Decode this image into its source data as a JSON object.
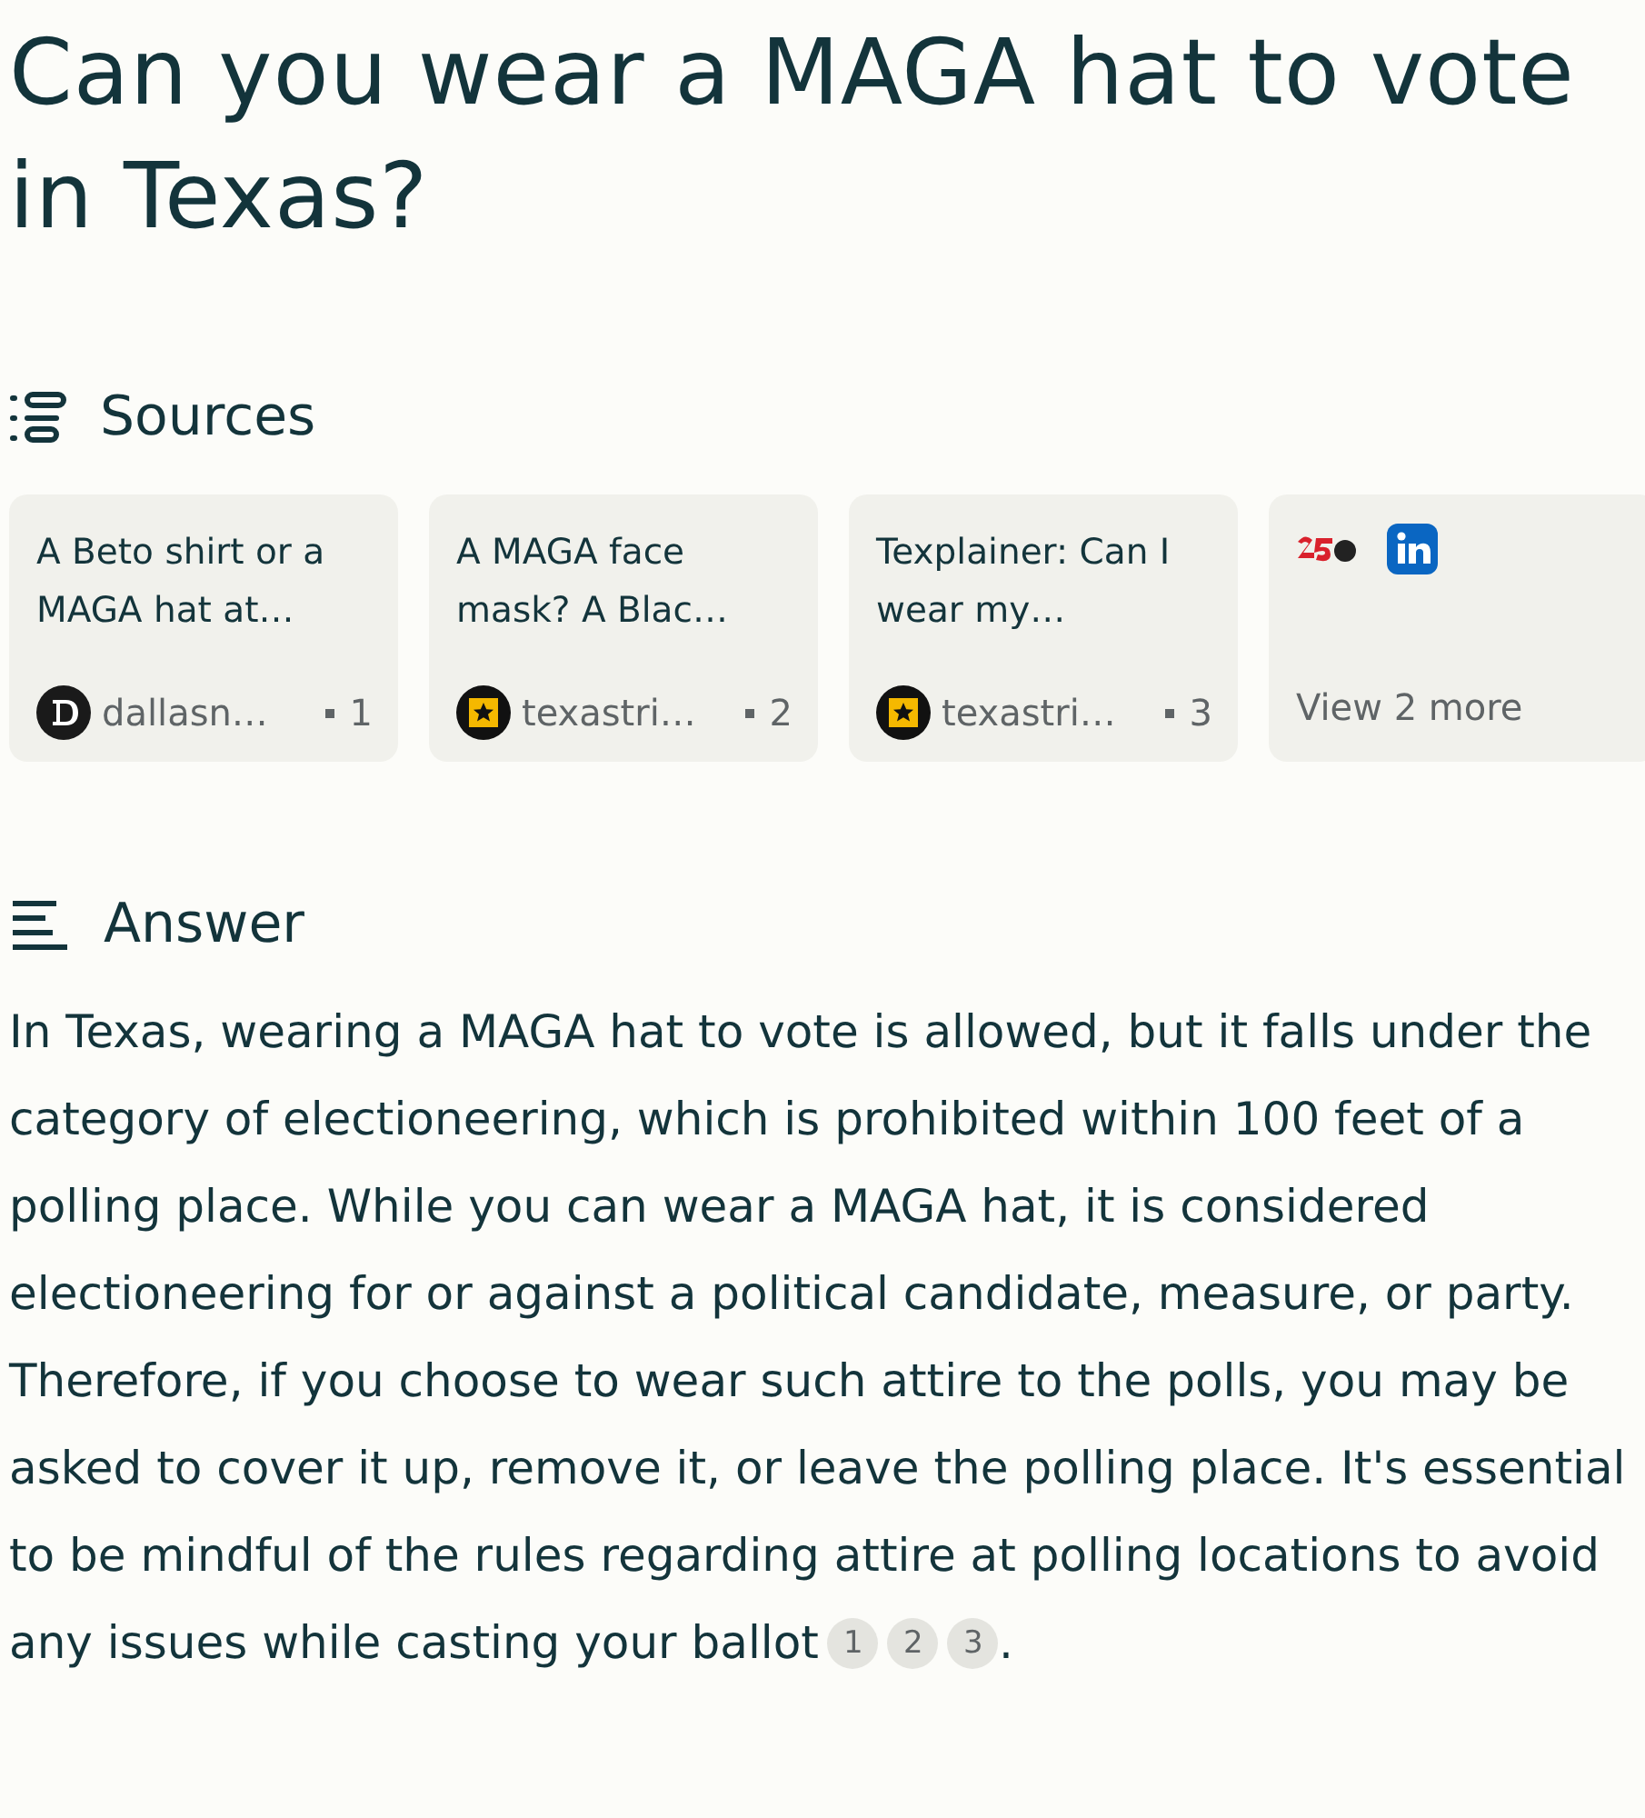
{
  "title": "Can you wear a MAGA hat to vote in Texas?",
  "sources": {
    "heading": "Sources",
    "cards": [
      {
        "kind": "source",
        "title": "A Beto shirt or a MAGA hat at…",
        "site": "dallasn…",
        "logo": {
          "kind": "dallas"
        },
        "number": "1"
      },
      {
        "kind": "source",
        "title": "A MAGA face mask? A Blac…",
        "site": "texastri…",
        "logo": {
          "kind": "star"
        },
        "number": "2"
      },
      {
        "kind": "source",
        "title": "Texplainer: Can I wear my…",
        "site": "texastri…",
        "logo": {
          "kind": "star"
        },
        "number": "3"
      },
      {
        "kind": "more",
        "logos": [
          {
            "kind": "tv"
          },
          {
            "kind": "linkedin"
          }
        ],
        "label": "View 2 more"
      }
    ]
  },
  "answer": {
    "heading": "Answer",
    "text": "In Texas, wearing a MAGA hat to vote is allowed, but it falls under the category of electioneering, which is prohibited within 100 feet of a polling place. While you can wear a MAGA hat, it is considered electioneering for or against a political candidate, measure, or party. Therefore, if you choose to wear such attire to the polls, you may be asked to cover it up, remove it, or leave the polling place. It's essential to be mindful of the rules regarding attire at polling locations to avoid any issues while casting your ballot",
    "citations": [
      "1",
      "2",
      "3"
    ],
    "end": "."
  }
}
